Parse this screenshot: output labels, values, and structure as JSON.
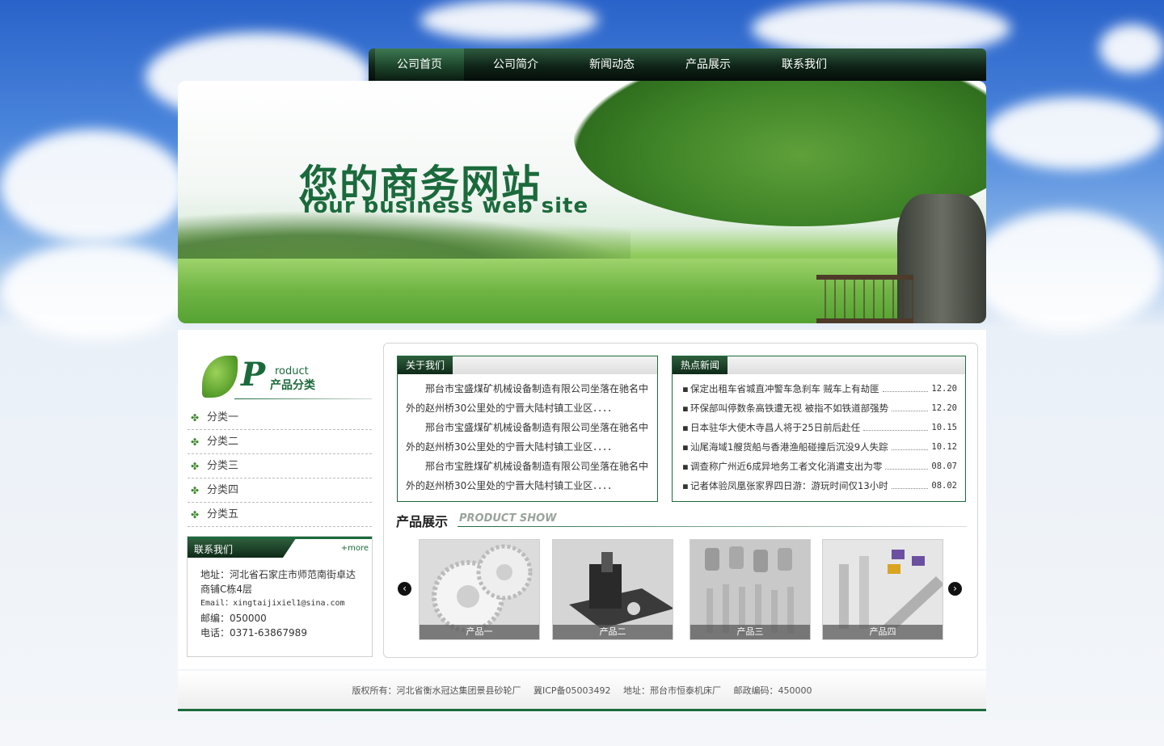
{
  "nav": {
    "items": [
      {
        "label": "公司首页"
      },
      {
        "label": "公司简介"
      },
      {
        "label": "新闻动态"
      },
      {
        "label": "产品展示"
      },
      {
        "label": "联系我们"
      }
    ]
  },
  "banner": {
    "title_cn": "您的商务网站",
    "title_en": "Your business web site"
  },
  "sidebar": {
    "product_head": {
      "big_letter": "P",
      "en": "roduct",
      "cn": "产品分类"
    },
    "categories": [
      "分类一",
      "分类二",
      "分类三",
      "分类四",
      "分类五"
    ],
    "contact": {
      "title": "联系我们",
      "more": "+more",
      "address": "地址：河北省石家庄市师范南街卓达商铺C栋4层",
      "email": "Email：xingtaijixiel1@sina.com",
      "postcode": "邮编：050000",
      "phone": "电话：0371-63867989"
    }
  },
  "about": {
    "title": "关于我们",
    "paragraphs": [
      "　　邢台市宝盛煤矿机械设备制造有限公司坐落在驰名中外的赵州桥30公里处的宁晋大陆村镇工业区．．．．",
      "　　邢台市宝盛煤矿机械设备制造有限公司坐落在驰名中外的赵州桥30公里处的宁晋大陆村镇工业区．．．．",
      "　　邢台市宝胜煤矿机械设备制造有限公司坐落在驰名中外的赵州桥30公里处的宁晋大陆村镇工业区．．．．"
    ]
  },
  "news": {
    "title": "热点新闻",
    "items": [
      {
        "text": "保定出租车省城直冲警车急刹车 贼车上有劫匪",
        "date": "12.20"
      },
      {
        "text": "环保部叫停数条高铁遭无视 被指不如铁道部强势",
        "date": "12.20"
      },
      {
        "text": "日本驻华大使木寺昌人将于25日前后赴任",
        "date": "10.15"
      },
      {
        "text": "汕尾海域1艘货船与香港渔船碰撞后沉没9人失踪",
        "date": "10.12"
      },
      {
        "text": "调查称广州近6成异地务工者文化消遣支出为零",
        "date": "08.07"
      },
      {
        "text": "记者体验凤凰张家界四日游：游玩时间仅13小时",
        "date": "08.02"
      }
    ]
  },
  "products": {
    "title": "产品展示",
    "title_en": "PRODUCT SHOW",
    "items": [
      {
        "caption": "产品一"
      },
      {
        "caption": "产品二"
      },
      {
        "caption": "产品三"
      },
      {
        "caption": "产品四"
      }
    ]
  },
  "footer": {
    "copyright": "版权所有：河北省衡水冠达集团景县砂轮厂",
    "icp": "冀ICP备05003492",
    "address": "地址：邢台市恒泰机床厂",
    "postcode": "邮政编码：450000"
  },
  "colors": {
    "brand_green": "#1b6a3c",
    "nav_dark": "#0f2418"
  }
}
